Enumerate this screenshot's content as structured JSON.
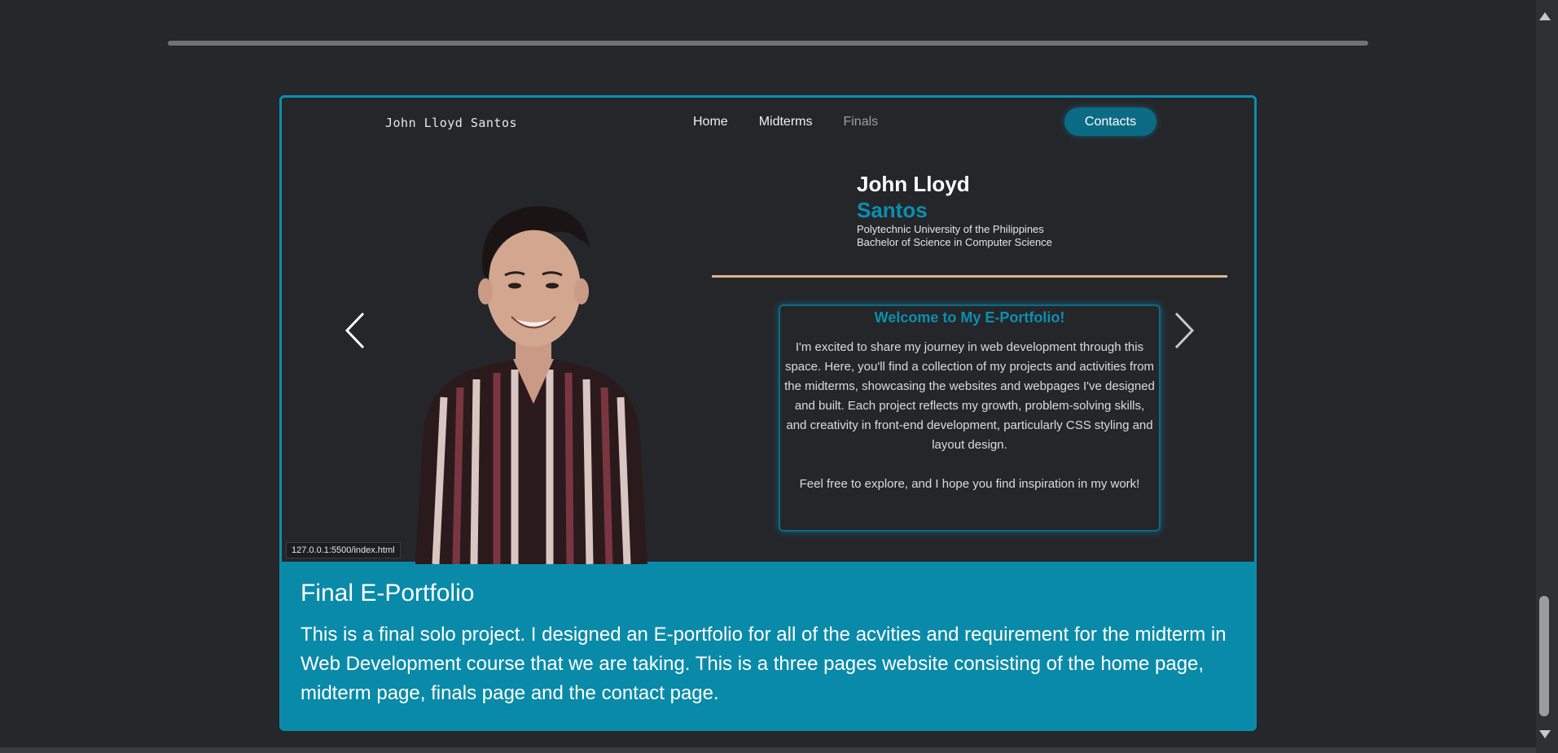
{
  "project": {
    "title": "Final E-Portfolio",
    "description": "This is a final solo project. I designed an E-portfolio for all of the acvities and requirement for the midterm in Web Development course that we are taking. This is a three pages website consisting of the home page, midterm page, finals page and the contact page."
  },
  "preview": {
    "brand": "John Lloyd Santos",
    "nav": {
      "home": "Home",
      "midterms": "Midterms",
      "finals": "Finals",
      "contacts": "Contacts"
    },
    "profile": {
      "first_name": "John Lloyd",
      "last_name": "Santos",
      "school": "Polytechnic University of the Philippines",
      "degree": "Bachelor of Science in Computer Science"
    },
    "welcome": {
      "title": "Welcome to My E-Portfolio!",
      "body": "I'm excited to share my journey in web development through this space. Here, you'll find a collection of my projects and activities from the midterms, showcasing the websites and webpages I've designed and built. Each project reflects my growth, problem-solving skills, and creativity in front-end development, particularly CSS styling and layout design.",
      "closing": "Feel free to explore, and I hope you find inspiration in my work!"
    },
    "status_url": "127.0.0.1:5500/index.html"
  },
  "colors": {
    "background": "#25272b",
    "accent": "#0b8fae",
    "card": "#0a8aa9",
    "divider": "#d8b48f"
  },
  "icons": {
    "left": "chevron-left-icon",
    "right": "chevron-right-icon"
  }
}
